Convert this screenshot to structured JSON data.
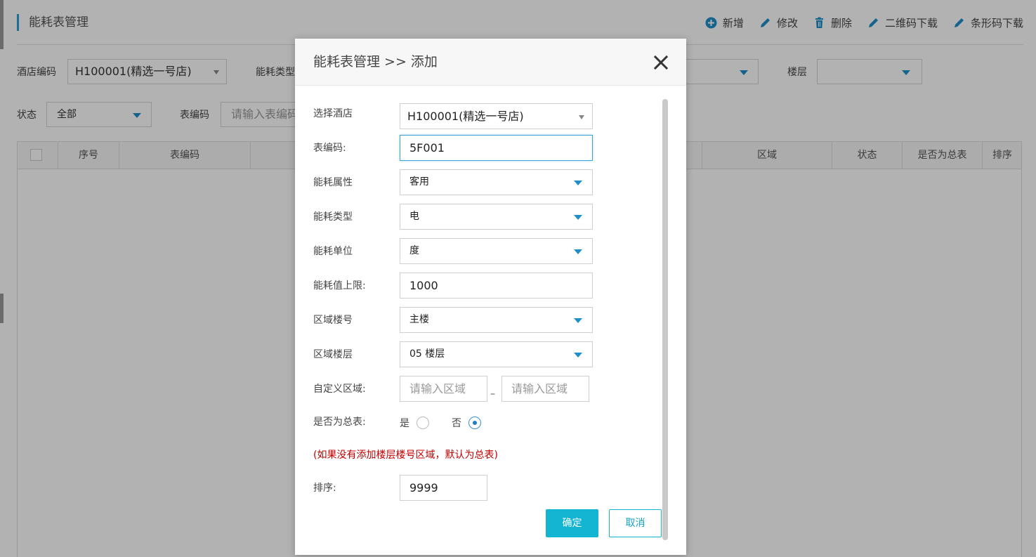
{
  "page": {
    "title": "能耗表管理",
    "toolbar": [
      {
        "label": "新增",
        "icon": "plus-circle-icon"
      },
      {
        "label": "修改",
        "icon": "pencil-icon"
      },
      {
        "label": "删除",
        "icon": "trash-icon"
      },
      {
        "label": "二维码下载",
        "icon": "pencil-icon"
      },
      {
        "label": "条形码下载",
        "icon": "pencil-icon"
      }
    ],
    "filters": {
      "hotel_label": "酒店编码",
      "hotel_value": "H100001(精选一号店)",
      "energy_type_label": "能耗类型",
      "floor_label": "楼层",
      "floor_value": "",
      "status_label": "状态",
      "status_value": "全部",
      "code_label": "表编码",
      "code_placeholder": "请输入表编码"
    },
    "table_headers": {
      "index": "序号",
      "code": "表编码",
      "area": "区域",
      "status": "状态",
      "is_master": "是否为总表",
      "sort": "排序"
    }
  },
  "modal": {
    "title": "能耗表管理 >> 添加",
    "fields": {
      "hotel_label": "选择酒店",
      "hotel_value": "H100001(精选一号店)",
      "code_label": "表编码:",
      "code_value": "5F001",
      "attr_label": "能耗属性",
      "attr_value": "客用",
      "type_label": "能耗类型",
      "type_value": "电",
      "unit_label": "能耗单位",
      "unit_value": "度",
      "limit_label": "能耗值上限:",
      "limit_value": "1000",
      "building_label": "区域楼号",
      "building_value": "主楼",
      "floor_label": "区域楼层",
      "floor_value": "05 楼层",
      "custom_label": "自定义区域:",
      "custom_placeholder_1": "请输入区域",
      "custom_placeholder_2": "请输入区域",
      "custom_dash": "–",
      "master_label": "是否为总表:",
      "master_yes": "是",
      "master_no": "否",
      "master_selected": "否",
      "note": "(如果没有添加楼层楼号区域，默认为总表)",
      "sort_label": "排序:",
      "sort_value": "9999"
    },
    "buttons": {
      "ok": "确定",
      "cancel": "取消"
    }
  },
  "colors": {
    "accent": "#13b5d3",
    "dropdown_arrow": "#1e8fc9",
    "note_red": "#c00000",
    "title_bar": "#2a9fd6"
  }
}
